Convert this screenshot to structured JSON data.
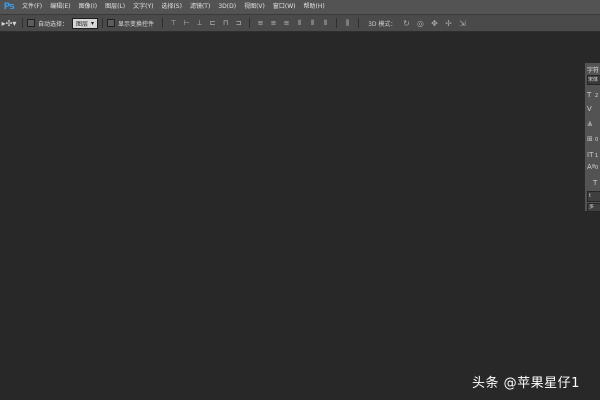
{
  "app": {
    "logo": "Ps"
  },
  "menu": [
    {
      "label": "文件(F)"
    },
    {
      "label": "编辑(E)"
    },
    {
      "label": "图像(I)"
    },
    {
      "label": "图层(L)"
    },
    {
      "label": "文字(Y)"
    },
    {
      "label": "选择(S)"
    },
    {
      "label": "滤镜(T)"
    },
    {
      "label": "3D(D)"
    },
    {
      "label": "视图(V)"
    },
    {
      "label": "窗口(W)"
    },
    {
      "label": "帮助(H)"
    }
  ],
  "options": {
    "tool_icon": "move-tool-icon",
    "auto_select_label": "自动选择：",
    "auto_select_target": "图层",
    "transform_controls_label": "显示变换控件",
    "mode3d_label": "3D 模式："
  },
  "panel": {
    "title": "字符",
    "font_family": "宋体",
    "font_size": "2",
    "tracking": "0",
    "scale": "1",
    "baseline": "0",
    "tt_label": "T",
    "language_button": "t",
    "bottom_button": "多"
  },
  "watermark": {
    "text": "头条 @苹果星仔1"
  }
}
